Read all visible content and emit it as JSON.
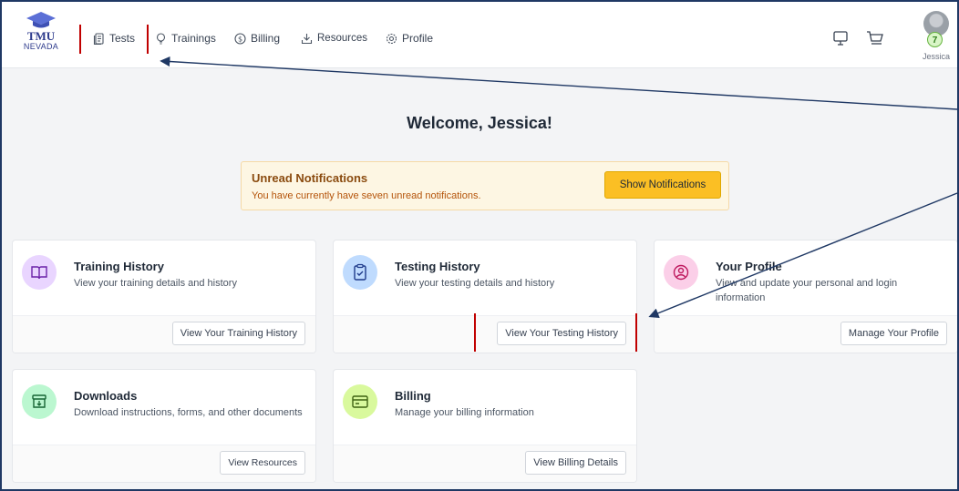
{
  "brand": {
    "line1": "TMU",
    "line2": "NEVADA"
  },
  "nav": {
    "tests": "Tests",
    "trainings": "Trainings",
    "billing": "Billing",
    "resources": "Resources",
    "profile": "Profile"
  },
  "header_icons": [
    "monitor-icon",
    "cart-icon"
  ],
  "user": {
    "name": "Jessica",
    "badge": "7"
  },
  "welcome": "Welcome, Jessica!",
  "notifications": {
    "title": "Unread Notifications",
    "message": "You have currently have seven unread notifications.",
    "button": "Show Notifications"
  },
  "cards": [
    {
      "title": "Training History",
      "description": "View your training details and history",
      "button": "View Your Training History",
      "icon": "book-icon",
      "color": "#e9d5ff"
    },
    {
      "title": "Testing History",
      "description": "View your testing details and history",
      "button": "View Your Testing History",
      "icon": "clipboard-check-icon",
      "color": "#bfdbfe"
    },
    {
      "title": "Your Profile",
      "description": "View and update your personal and login information",
      "button": "Manage Your Profile",
      "icon": "user-circle-icon",
      "color": "#fbcfe8"
    },
    {
      "title": "Downloads",
      "description": "Download instructions, forms, and other documents",
      "button": "View Resources",
      "icon": "archive-download-icon",
      "color": "#bbf7d0"
    },
    {
      "title": "Billing",
      "description": "Manage your billing information",
      "button": "View Billing Details",
      "icon": "credit-card-icon",
      "color": "#d9f99d"
    }
  ],
  "colors": {
    "accent": "#fbbf24",
    "annotation": "#c00000",
    "arrow": "#1f3864"
  }
}
